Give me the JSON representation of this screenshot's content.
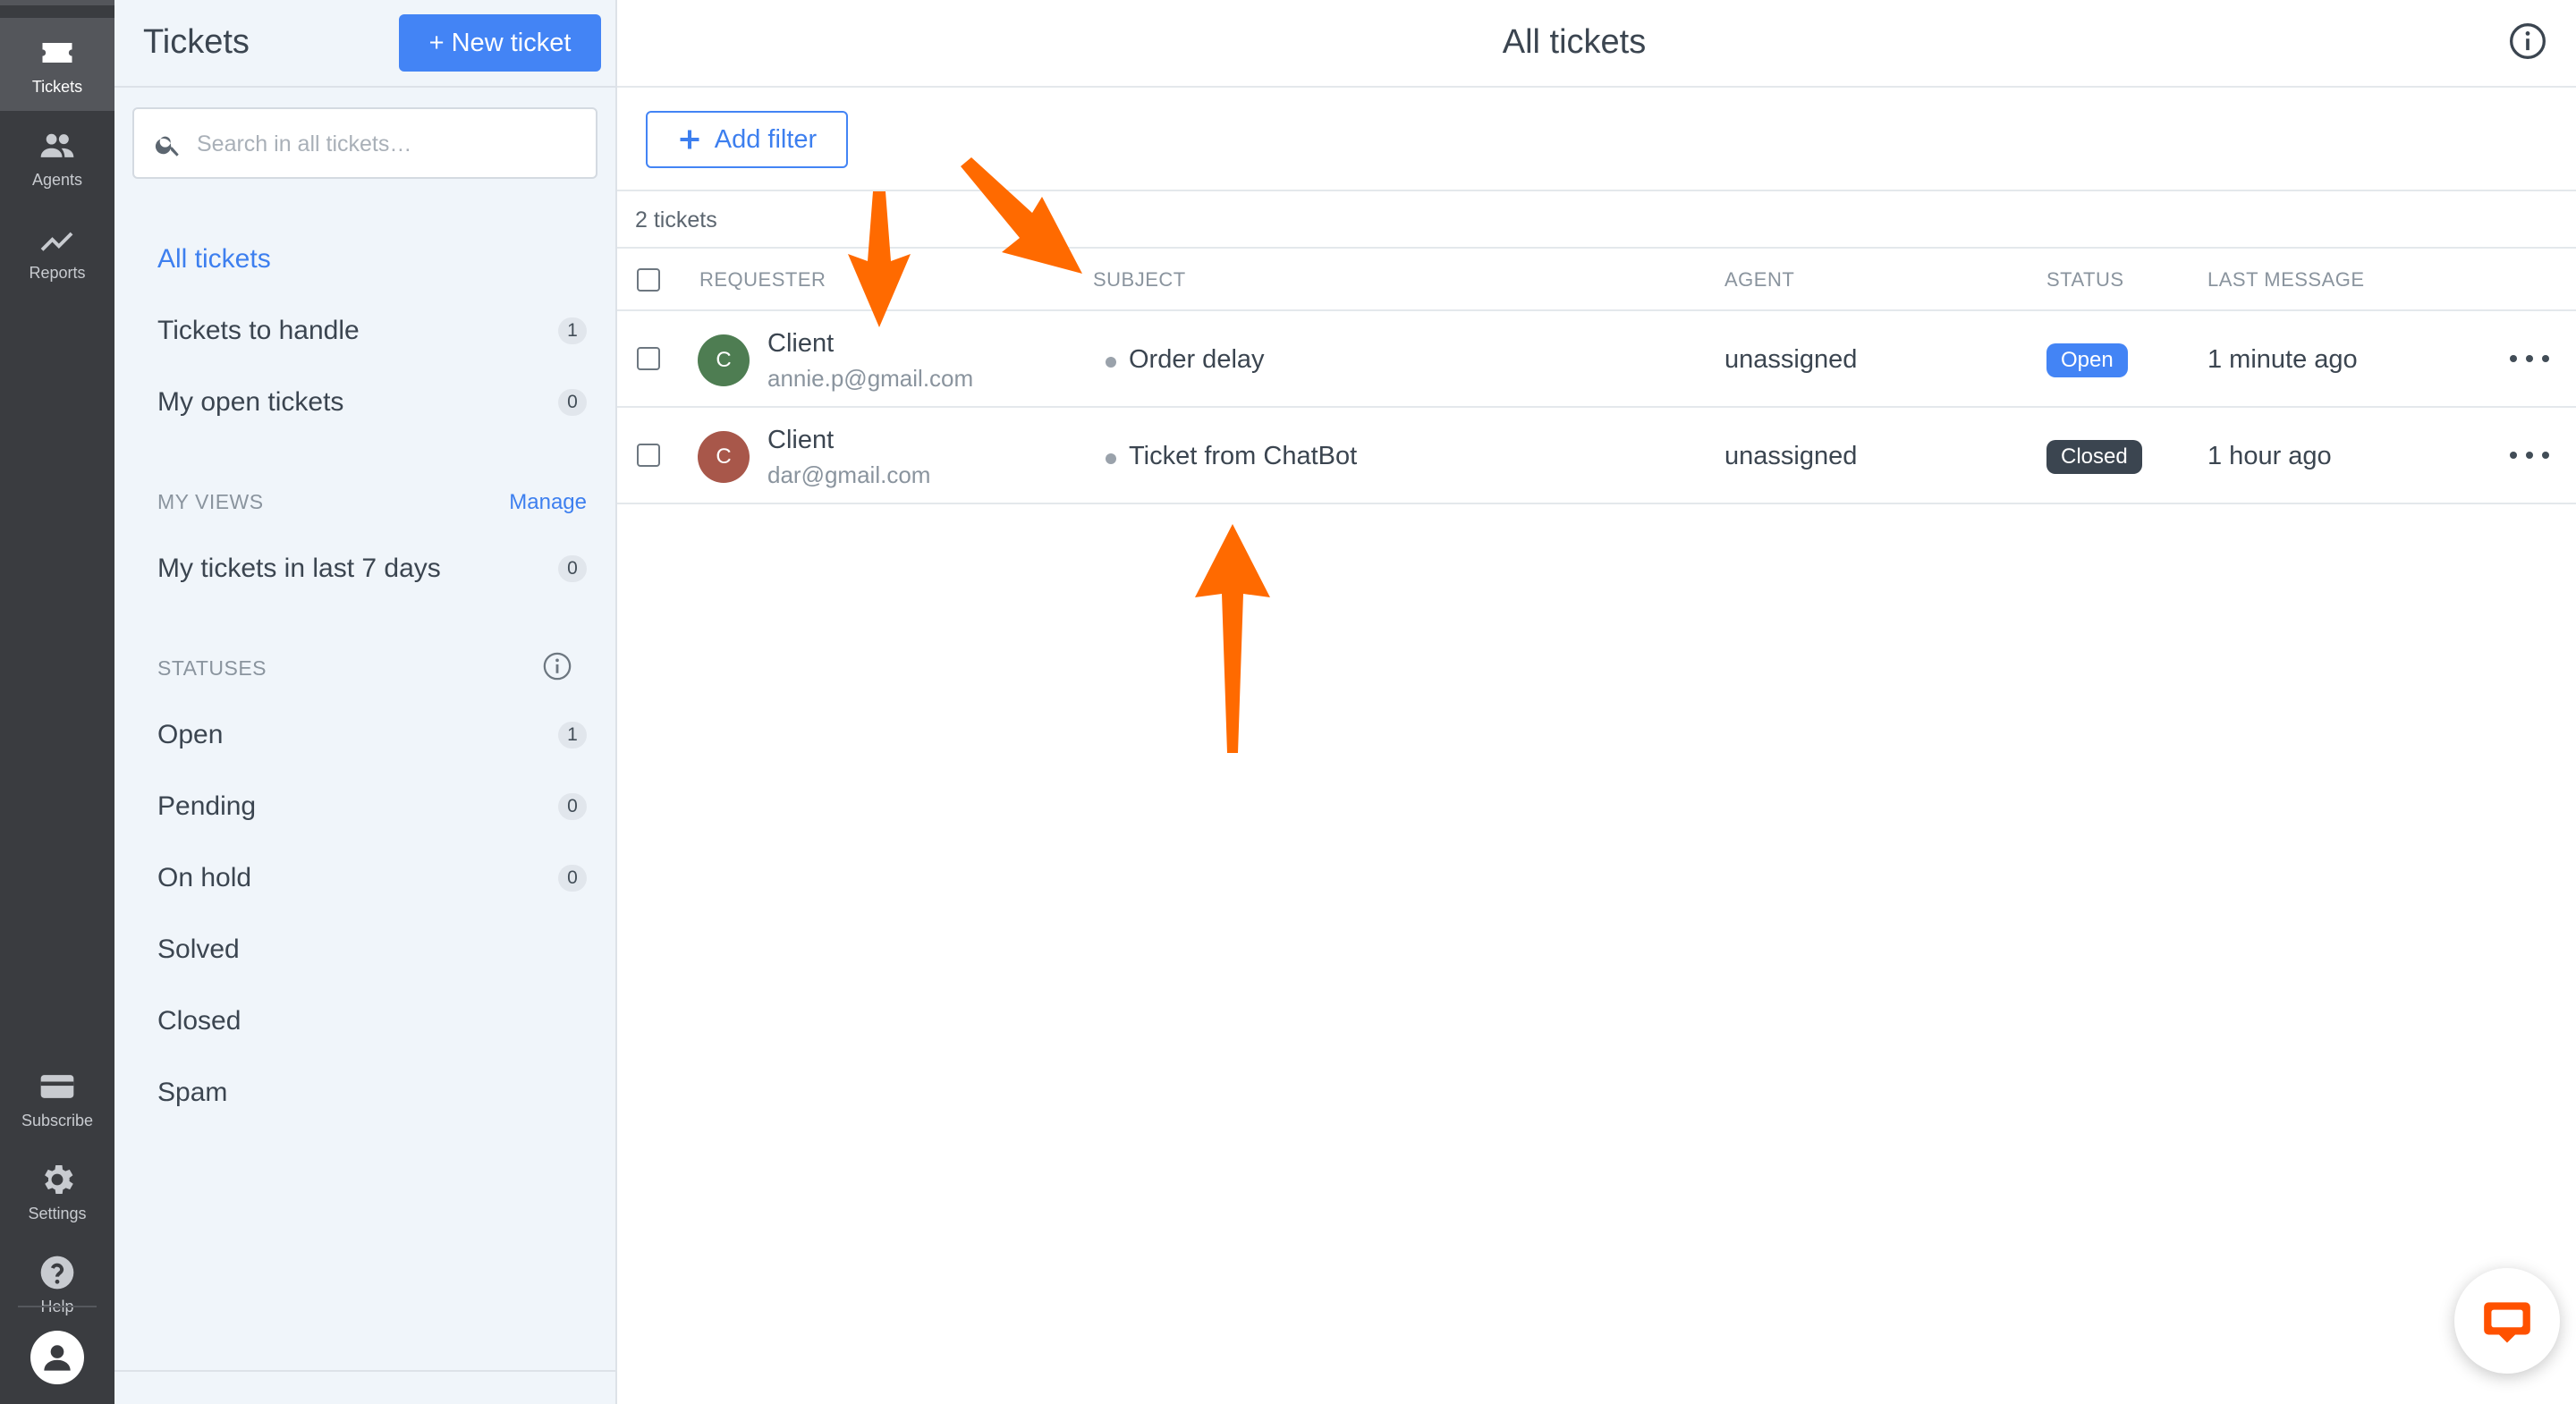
{
  "rail": {
    "items": [
      {
        "label": "Tickets",
        "icon": "ticket-icon",
        "active": true
      },
      {
        "label": "Agents",
        "icon": "agents-icon"
      },
      {
        "label": "Reports",
        "icon": "reports-icon"
      }
    ],
    "bottom": [
      {
        "label": "Subscribe",
        "icon": "subscribe-icon"
      },
      {
        "label": "Settings",
        "icon": "gear-icon"
      },
      {
        "label": "Help",
        "icon": "help-icon"
      }
    ]
  },
  "sidebar": {
    "title": "Tickets",
    "new_ticket_label": "+ New ticket",
    "search_placeholder": "Search in all tickets…",
    "nav": [
      {
        "label": "All tickets",
        "active": true
      },
      {
        "label": "Tickets to handle",
        "count": "1"
      },
      {
        "label": "My open tickets",
        "count": "0"
      }
    ],
    "my_views_label": "MY VIEWS",
    "manage_label": "Manage",
    "views": [
      {
        "label": "My tickets in last 7 days",
        "count": "0"
      }
    ],
    "statuses_label": "STATUSES",
    "statuses": [
      {
        "label": "Open",
        "count": "1"
      },
      {
        "label": "Pending",
        "count": "0"
      },
      {
        "label": "On hold",
        "count": "0"
      },
      {
        "label": "Solved"
      },
      {
        "label": "Closed"
      },
      {
        "label": "Spam"
      }
    ]
  },
  "main": {
    "title": "All tickets",
    "add_filter_label": "Add filter",
    "ticket_count": "2 tickets",
    "columns": {
      "requester": "REQUESTER",
      "subject": "SUBJECT",
      "agent": "AGENT",
      "status": "STATUS",
      "last_message": "LAST MESSAGE"
    },
    "rows": [
      {
        "initial": "C",
        "name": "Client",
        "email": "annie.p@gmail.com",
        "avatar_color": "#4e7d52",
        "subject": "Order delay",
        "agent": "unassigned",
        "status": "Open",
        "status_color": "#4384f5",
        "last_message": "1 minute ago"
      },
      {
        "initial": "C",
        "name": "Client",
        "email": "dar@gmail.com",
        "avatar_color": "#a8574a",
        "subject": "Ticket from ChatBot",
        "agent": "unassigned",
        "status": "Closed",
        "status_color": "#3b4550",
        "last_message": "1 hour ago"
      }
    ]
  },
  "colors": {
    "accent": "#4384f5",
    "rail_bg": "#3a3c40",
    "sidebar_bg": "#f0f5fa",
    "annotation_arrow": "#ff6a00",
    "chat_brand": "#ff5100"
  }
}
